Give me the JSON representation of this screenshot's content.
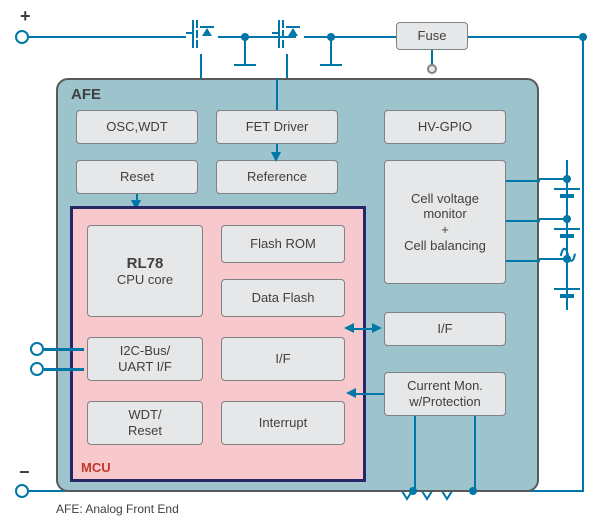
{
  "terminals": {
    "plus": "+",
    "minus": "−"
  },
  "fuse": "Fuse",
  "afe": {
    "title": "AFE",
    "osc_wdt": "OSC,WDT",
    "fet_driver": "FET Driver",
    "hv_gpio": "HV-GPIO",
    "reset": "Reset",
    "reference": "Reference",
    "cell_block": "Cell voltage monitor\n+\nCell balancing",
    "if_right": "I/F",
    "current_mon": "Current Mon. w/Protection"
  },
  "mcu": {
    "label": "MCU",
    "cpu_bold": "RL78",
    "cpu_sub": "CPU core",
    "flash_rom": "Flash ROM",
    "data_flash": "Data Flash",
    "i2c_uart": "I2C-Bus/\nUART I/F",
    "if_center": "I/F",
    "wdt_reset": "WDT/\nReset",
    "interrupt": "Interrupt"
  },
  "footnote": "AFE: Analog Front End",
  "colors": {
    "wire": "#0077a6",
    "mcu_border": "#26276a",
    "mcu_fill": "#f8c9cc",
    "afe_fill": "#9dc3cd",
    "block_fill": "#e6e7e8"
  }
}
